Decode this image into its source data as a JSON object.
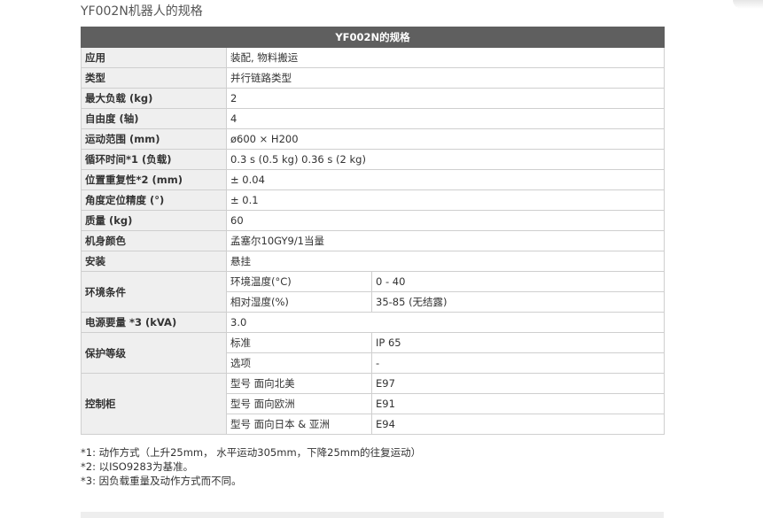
{
  "page_title": "YF002N机器人的规格",
  "table": {
    "header": "YF002N的规格",
    "rows": {
      "application": {
        "label": "应用",
        "value": "装配, 物料搬运"
      },
      "type": {
        "label": "类型",
        "value": "并行链路类型"
      },
      "max_payload": {
        "label": "最大负载 (kg)",
        "value": "2"
      },
      "dof": {
        "label": "自由度 (轴)",
        "value": "4"
      },
      "motion_range": {
        "label": "运动范围 (mm)",
        "value": "ø600 × H200"
      },
      "cycle_time": {
        "label": "循环时间*1 (负载)",
        "value": "0.3 s (0.5 kg) 0.36 s (2 kg)"
      },
      "repeatability": {
        "label": "位置重复性*2 (mm)",
        "value": "± 0.04"
      },
      "angle_accuracy": {
        "label": "角度定位精度 (°)",
        "value": "± 0.1"
      },
      "mass": {
        "label": "质量 (kg)",
        "value": "60"
      },
      "body_color": {
        "label": "机身颜色",
        "value": "孟塞尔10GY9/1当量"
      },
      "installation": {
        "label": "安装",
        "value": "悬挂"
      },
      "environment": {
        "label": "环境条件",
        "temp_label": "环境温度(°C)",
        "temp_value": "0 - 40",
        "humidity_label": "相对湿度(%)",
        "humidity_value": "35-85 (无结露)"
      },
      "power": {
        "label": "电源要量 *3 (kVA)",
        "value": "3.0"
      },
      "protection": {
        "label": "保护等级",
        "std_label": "标准",
        "std_value": "IP 65",
        "opt_label": "选项",
        "opt_value": "-"
      },
      "controller": {
        "label": "控制柜",
        "na_label": "型号 面向北美",
        "na_value": "E97",
        "eu_label": "型号 面向欧洲",
        "eu_value": "E91",
        "jp_label": "型号 面向日本 & 亚洲",
        "jp_value": "E94"
      }
    }
  },
  "notes": [
    "*1: 动作方式（上升25mm， 水平运动305mm，下降25mm的往复运动）",
    "*2: 以ISO9283为基准。",
    "*3: 因负载重量及动作方式而不同。"
  ],
  "colors": {
    "header_bg": "#5f5f5f",
    "label_bg": "#efefef",
    "border": "#cfcfcf"
  }
}
